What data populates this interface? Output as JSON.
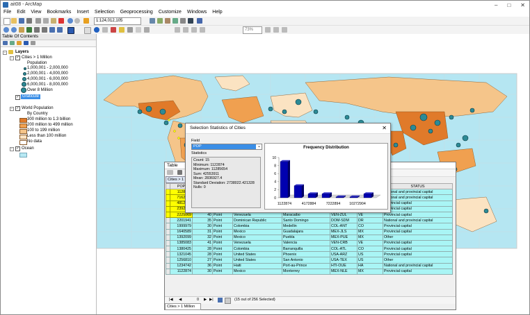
{
  "window": {
    "title": "ait08 - ArcMap"
  },
  "menu": [
    "File",
    "Edit",
    "View",
    "Bookmarks",
    "Insert",
    "Selection",
    "Geoprocessing",
    "Customize",
    "Windows",
    "Help"
  ],
  "toolbar": {
    "scale": "1:124,012,105",
    "zoom": "73%"
  },
  "toc": {
    "title": "Table Of Contents",
    "layers_label": "Layers",
    "cities_layer": "Cities > 1 Million",
    "population_label": "Population",
    "pop_classes": [
      "1,000,001 - 2,000,000",
      "2,000,001 - 4,000,000",
      "4,000,001 - 6,000,000",
      "6,000,001 - 8,000,000",
      "Over 8 Million"
    ],
    "graticule": "Graticule",
    "world_pop": "World Population",
    "by_country": "By Country",
    "country_classes": [
      "300 million to 1.3 billion",
      "200 million to 499 million",
      "100 to 199 million",
      "Less than 100 million",
      "No data"
    ],
    "country_colors": [
      "#e07a2a",
      "#f0a050",
      "#f5c58a",
      "#fbe3c2",
      "#ffffff"
    ],
    "ocean": "Ocean"
  },
  "dialog": {
    "title": "Selection Statistics of Cities",
    "field_label": "Field",
    "field_value": "POP",
    "stats_label": "Statistics",
    "stats": [
      "Count:   15",
      "Minimum:  1122874",
      "Maximum:  11285654",
      "Sum:     42553911",
      "Mean:    2836927.4",
      "Standard Deviation:  2738022.421328",
      "Nulls:   0"
    ],
    "close": "✕"
  },
  "chart_data": {
    "type": "bar",
    "title": "Frequency Distribution",
    "categories": [
      "1122874",
      "4172884",
      "7222894",
      "10272904"
    ],
    "values": [
      9,
      3,
      1,
      1,
      0,
      0,
      1
    ],
    "yticks": [
      0,
      2,
      4,
      6,
      8,
      10
    ],
    "ylim": [
      0,
      10
    ]
  },
  "table": {
    "title": "Table",
    "tab_label": "Cities > 1 Million",
    "status_header": "STATUS",
    "col2_header": "Y",
    "pop_header": "POP",
    "rows": [
      {
        "pop": "1128866",
        "id": "",
        "shape": "",
        "country": "",
        "city": "",
        "code": "",
        "cc": "",
        "status": "National and provincial capital",
        "sel": true
      },
      {
        "pop": "7162661",
        "id": "",
        "shape": "",
        "country": "",
        "city": "",
        "code": "",
        "cc": "",
        "status": "National and provincial capital",
        "sel": true
      },
      {
        "pop": "4812189",
        "id": "",
        "shape": "",
        "country": "",
        "city": "",
        "code": "",
        "cc": "",
        "status": "Provincial capital",
        "sel": true
      },
      {
        "pop": "2392870",
        "id": "",
        "shape": "",
        "country": "",
        "city": "",
        "code": "",
        "cc": "",
        "status": "Provincial capital",
        "sel": true
      },
      {
        "pop": "2225069",
        "id": "40",
        "shape": "Point",
        "country": "Venezuela",
        "city": "Maracaibo",
        "code": "VEN-ZUL",
        "cc": "VE",
        "status": "Provincial capital",
        "sel": true
      },
      {
        "pop": "2201941",
        "id": "35",
        "shape": "Point",
        "country": "Dominican Republic",
        "city": "Santo Domingo",
        "code": "DOM-SDM",
        "cc": "DR",
        "status": "National and provincial capital",
        "sel": false
      },
      {
        "pop": "1999979",
        "id": "30",
        "shape": "Point",
        "country": "Colombia",
        "city": "Medellin",
        "code": "COL-ANT",
        "cc": "CO",
        "status": "Provincial capital",
        "sel": false
      },
      {
        "pop": "1640589",
        "id": "31",
        "shape": "Point",
        "country": "Mexico",
        "city": "Guadalajara",
        "code": "MEX-JLS",
        "cc": "MX",
        "status": "Provincial capital",
        "sel": false
      },
      {
        "pop": "1392099",
        "id": "32",
        "shape": "Point",
        "country": "Mexico",
        "city": "Puebla",
        "code": "MEX-PUE",
        "cc": "MX",
        "status": "Other",
        "sel": false
      },
      {
        "pop": "1385083",
        "id": "41",
        "shape": "Point",
        "country": "Venezuela",
        "city": "Valencia",
        "code": "VEN-CRB",
        "cc": "VE",
        "status": "Provincial capital",
        "sel": false
      },
      {
        "pop": "1380425",
        "id": "28",
        "shape": "Point",
        "country": "Colombia",
        "city": "Barranquilla",
        "code": "COL-ATL",
        "cc": "CO",
        "status": "Provincial capital",
        "sel": false
      },
      {
        "pop": "1321045",
        "id": "28",
        "shape": "Point",
        "country": "United States",
        "city": "Phoenix",
        "code": "USA-ARZ",
        "cc": "US",
        "status": "Provincial capital",
        "sel": false
      },
      {
        "pop": "1256810",
        "id": "27",
        "shape": "Point",
        "country": "United States",
        "city": "San Antonio",
        "code": "USA-TEX",
        "cc": "US",
        "status": "Other",
        "sel": false
      },
      {
        "pop": "1234742",
        "id": "36",
        "shape": "Point",
        "country": "Haiti",
        "city": "Port-au-Prince",
        "code": "HTI-OUE",
        "cc": "HA",
        "status": "National and provincial capital",
        "sel": false
      },
      {
        "pop": "1122874",
        "id": "30",
        "shape": "Point",
        "country": "Mexico",
        "city": "Monterrey",
        "code": "MEX-NLE",
        "cc": "MX",
        "status": "Provincial capital",
        "sel": false
      }
    ],
    "record_pos": "0",
    "selection_text": "(15 out of 256 Selected)"
  }
}
